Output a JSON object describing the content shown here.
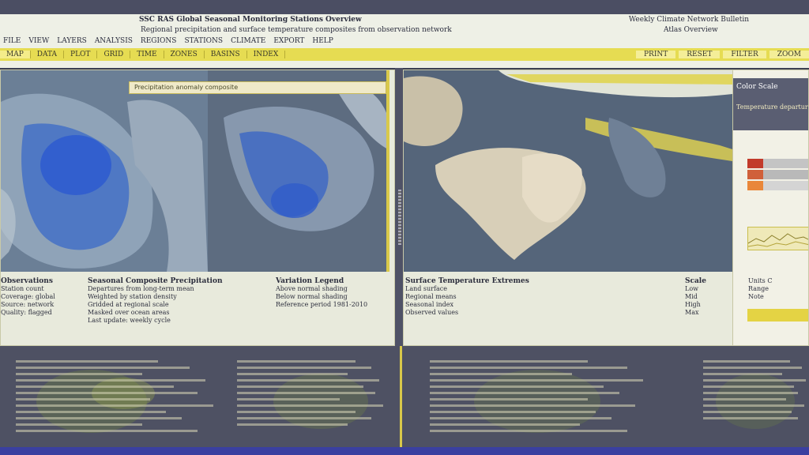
{
  "header": {
    "title": "SSC RAS Global Seasonal Monitoring Stations Overview",
    "title_right": "Weekly Climate Network Bulletin",
    "subtitle": "Regional precipitation and surface temperature composites from observation network",
    "subtitle_right": "Atlas Overview",
    "toolbar": [
      "FILE",
      "VIEW",
      "LAYERS",
      "ANALYSIS",
      "REGIONS",
      "STATIONS",
      "CLIMATE",
      "EXPORT",
      "HELP"
    ]
  },
  "tabs": {
    "items": [
      "MAP",
      "DATA",
      "PLOT",
      "GRID",
      "TIME",
      "ZONES",
      "BASINS",
      "INDEX"
    ],
    "right_tabs": [
      "PRINT",
      "RESET",
      "FILTER",
      "ZOOM"
    ]
  },
  "left_panel": {
    "map_label": "Precipitation anomaly composite",
    "caption1": {
      "heading": "Observations",
      "lines": [
        "Station count",
        "Coverage: global",
        "Source: network",
        "Quality: flagged"
      ]
    },
    "caption2": {
      "heading": "Seasonal Composite Precipitation",
      "lines": [
        "Departures from long-term mean",
        "Weighted by station density",
        "Gridded at regional scale",
        "Masked over ocean areas",
        "Last update: weekly cycle"
      ]
    },
    "caption3": {
      "heading": "Variation Legend",
      "lines": [
        "Above normal shading",
        "Below normal shading",
        "Reference period 1981-2010"
      ]
    }
  },
  "right_panel": {
    "caption1": {
      "heading": "Surface Temperature Extremes",
      "lines": [
        "Land surface",
        "Regional means",
        "Seasonal index",
        "Observed values"
      ]
    },
    "caption2": {
      "heading": "Scale",
      "lines": [
        "Low",
        "Mid",
        "High",
        "Max"
      ]
    },
    "caption3": {
      "heading": "",
      "lines": [
        "Units C",
        "Range",
        "Note"
      ]
    },
    "legend_title": "Color Scale",
    "legend_sub": "Temperature departure"
  },
  "colors": {
    "accent_yellow": "#e6dc52",
    "panel_bg": "#e8eadc",
    "dark_bg": "#4e5163",
    "swatch_red": "#c23a2a",
    "swatch_orange": "#e9873a"
  }
}
